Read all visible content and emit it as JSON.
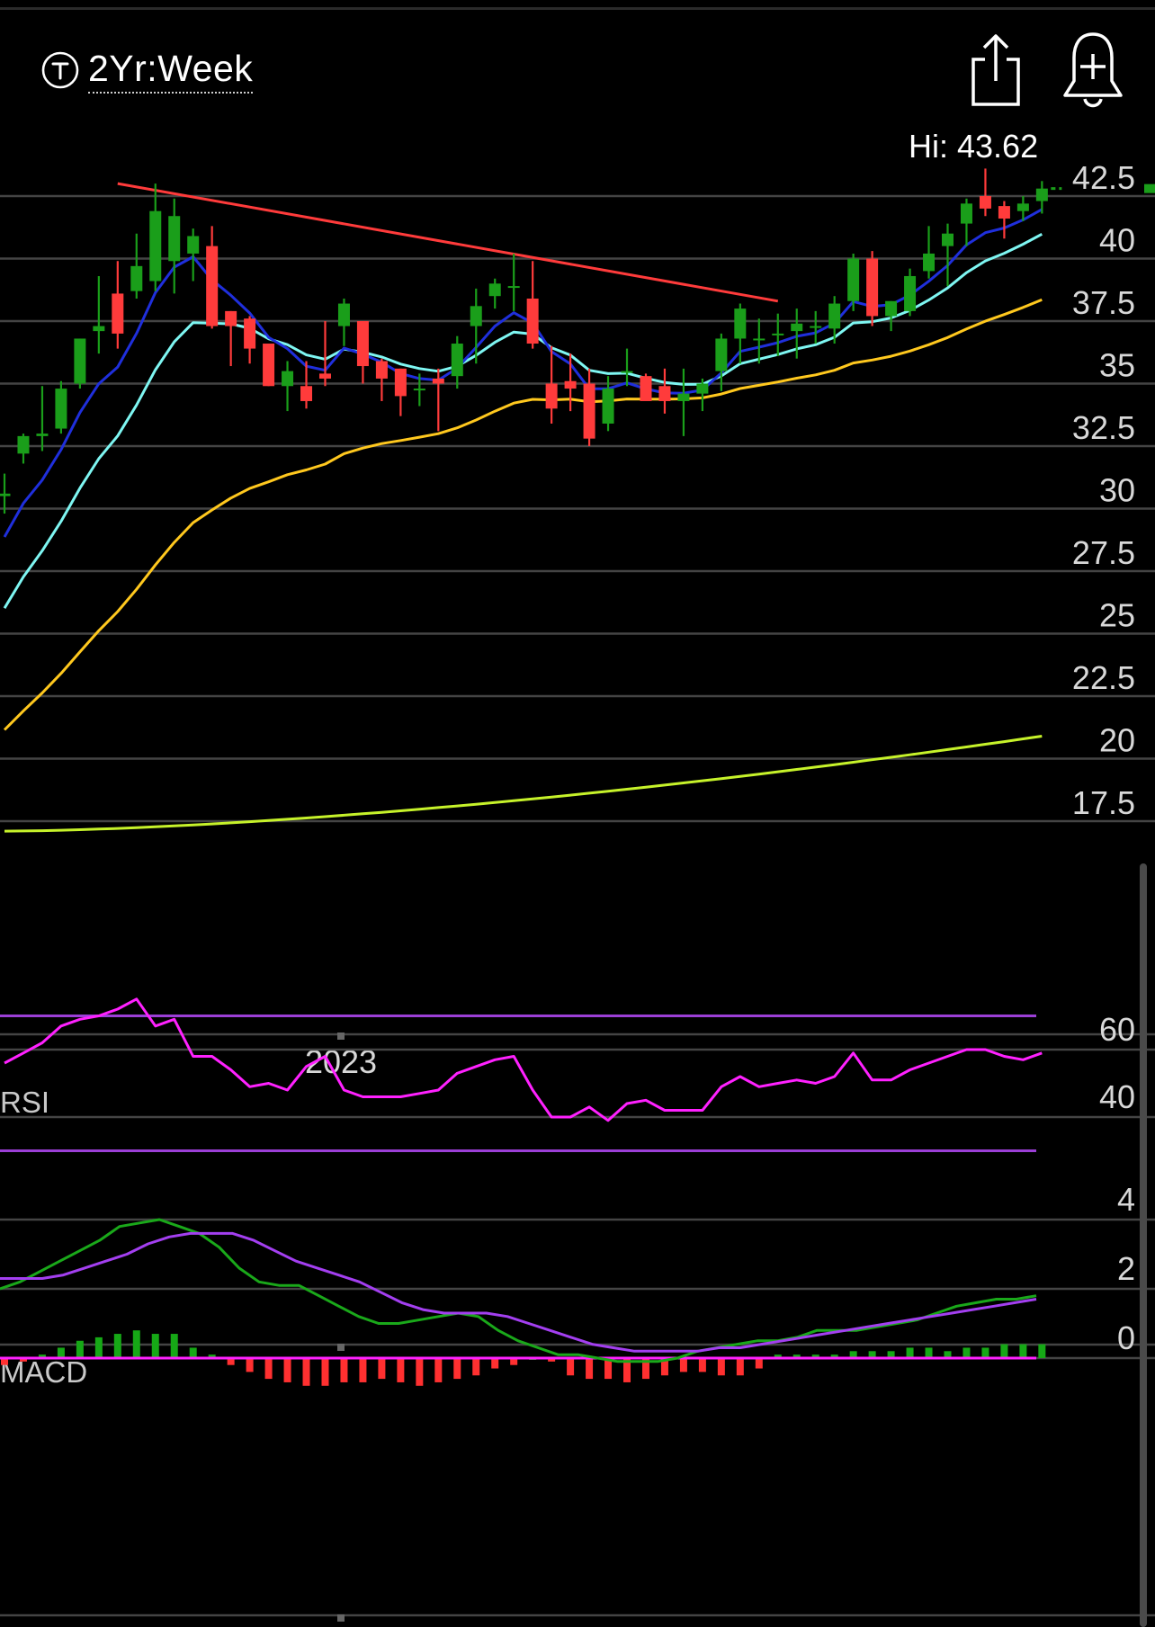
{
  "header": {
    "range_label": "2Yr:Week",
    "range_icon": "t-circle-icon",
    "share_icon": "share-icon",
    "alert_icon": "add-alert-bell-icon",
    "hi_label": "Hi: 43.62"
  },
  "chart_data": [
    {
      "type": "candlestick",
      "title": "",
      "x_label": "2023",
      "y_ticks": [
        "42.5",
        "40",
        "37.5",
        "35",
        "32.5",
        "30",
        "27.5",
        "25",
        "22.5",
        "20",
        "17.5"
      ],
      "y_tick_values": [
        42.5,
        40,
        37.5,
        35,
        32.5,
        30,
        27.5,
        25,
        22.5,
        20,
        17.5
      ],
      "ylim": [
        15,
        43.6
      ],
      "grid": true,
      "colors": {
        "up": "#1a9e1a",
        "down": "#ff3b3b",
        "ma_fast": "#1f2fdc",
        "ma_mid": "#7ef6f2",
        "ma_slow": "#ffc81e",
        "ma_long": "#c6f22a",
        "trendline": "#ff3b3b"
      },
      "candles": [
        [
          30.5,
          31.4,
          29.8,
          30.6
        ],
        [
          32.2,
          33.0,
          31.8,
          32.9
        ],
        [
          32.9,
          34.9,
          32.3,
          33.0
        ],
        [
          33.2,
          35.1,
          33.0,
          34.8
        ],
        [
          35.0,
          36.8,
          34.8,
          36.8
        ],
        [
          37.1,
          39.3,
          36.2,
          37.3
        ],
        [
          38.6,
          39.9,
          36.4,
          37.0
        ],
        [
          38.7,
          41.0,
          38.4,
          39.7
        ],
        [
          39.1,
          43.0,
          38.7,
          41.9
        ],
        [
          39.9,
          42.4,
          38.6,
          41.7
        ],
        [
          40.2,
          41.2,
          39.1,
          40.9
        ],
        [
          40.5,
          41.3,
          37.2,
          37.3
        ],
        [
          37.9,
          37.9,
          35.7,
          37.3
        ],
        [
          37.6,
          37.7,
          35.8,
          36.4
        ],
        [
          36.6,
          36.6,
          34.9,
          34.9
        ],
        [
          34.9,
          35.9,
          33.9,
          35.5
        ],
        [
          34.9,
          35.9,
          34.0,
          34.3
        ],
        [
          35.4,
          37.5,
          34.9,
          35.2
        ],
        [
          37.3,
          38.4,
          36.5,
          38.2
        ],
        [
          37.5,
          37.5,
          35.0,
          35.7
        ],
        [
          35.9,
          36.0,
          34.3,
          35.2
        ],
        [
          35.6,
          35.6,
          33.7,
          34.5
        ],
        [
          34.8,
          35.4,
          34.1,
          34.8
        ],
        [
          35.2,
          35.6,
          33.1,
          35.0
        ],
        [
          35.3,
          36.9,
          34.8,
          36.6
        ],
        [
          37.3,
          38.8,
          35.8,
          38.1
        ],
        [
          38.5,
          39.2,
          38.0,
          39.0
        ],
        [
          38.9,
          40.2,
          37.9,
          38.9
        ],
        [
          38.4,
          39.9,
          36.4,
          36.6
        ],
        [
          35.0,
          36.5,
          33.4,
          34.0
        ],
        [
          35.1,
          36.2,
          33.9,
          34.8
        ],
        [
          35.0,
          35.6,
          32.5,
          32.8
        ],
        [
          33.4,
          35.3,
          33.1,
          34.8
        ],
        [
          35.5,
          36.4,
          34.9,
          35.5
        ],
        [
          35.3,
          35.4,
          34.4,
          34.3
        ],
        [
          34.9,
          35.6,
          33.8,
          34.3
        ],
        [
          34.3,
          35.6,
          32.9,
          34.6
        ],
        [
          34.6,
          35.2,
          33.9,
          35.0
        ],
        [
          35.5,
          37.0,
          34.7,
          36.8
        ],
        [
          36.8,
          38.2,
          35.8,
          38.0
        ],
        [
          36.8,
          37.6,
          35.8,
          36.8
        ],
        [
          37.0,
          37.8,
          36.1,
          37.0
        ],
        [
          37.1,
          38.0,
          36.0,
          37.4
        ],
        [
          37.3,
          37.9,
          36.6,
          37.3
        ],
        [
          37.2,
          38.5,
          36.6,
          38.2
        ],
        [
          38.3,
          40.2,
          37.9,
          40.0
        ],
        [
          40.0,
          40.3,
          37.3,
          37.7
        ],
        [
          37.7,
          38.3,
          37.1,
          38.3
        ],
        [
          37.9,
          39.6,
          37.7,
          39.3
        ],
        [
          39.5,
          41.3,
          39.2,
          40.2
        ],
        [
          40.5,
          41.4,
          38.9,
          41.0
        ],
        [
          41.4,
          42.4,
          40.5,
          42.2
        ],
        [
          42.5,
          43.6,
          41.7,
          42.0
        ],
        [
          42.1,
          42.3,
          40.8,
          41.6
        ],
        [
          41.9,
          42.5,
          41.5,
          42.2
        ],
        [
          42.3,
          43.1,
          41.8,
          42.8
        ]
      ]
    },
    {
      "type": "line",
      "title": "RSI",
      "y_ticks": [
        "60",
        "40"
      ],
      "y_tick_values": [
        60,
        40
      ],
      "upper_band": 70,
      "lower_band": 30,
      "series": [
        {
          "values": [
            56,
            59,
            62,
            67,
            69,
            70,
            72,
            75,
            67,
            69,
            58,
            58,
            54,
            49,
            50,
            48,
            55,
            58,
            48,
            46,
            46,
            46,
            47,
            48,
            53,
            55,
            57,
            58,
            48,
            40,
            40,
            43,
            39,
            44,
            45,
            42,
            42,
            42,
            49,
            52,
            49,
            50,
            51,
            50,
            52,
            59,
            51,
            51,
            54,
            56,
            58,
            60,
            60,
            58,
            57,
            59
          ]
        }
      ]
    },
    {
      "type": "bar",
      "title": "MACD",
      "y_ticks": [
        "4",
        "2",
        "0"
      ],
      "y_tick_values": [
        4,
        2,
        0
      ],
      "ylim": [
        -1.6,
        4.6
      ],
      "series": [
        {
          "values": [
            2.0,
            2.2,
            2.5,
            2.8,
            3.1,
            3.4,
            3.8,
            3.9,
            4.0,
            3.8,
            3.6,
            3.2,
            2.6,
            2.2,
            2.1,
            2.1,
            1.8,
            1.5,
            1.2,
            1.0,
            1.0,
            1.1,
            1.2,
            1.3,
            1.2,
            0.8,
            0.5,
            0.3,
            0.1,
            0.1,
            0.0,
            -0.1,
            -0.1,
            -0.1,
            0.0,
            0.2,
            0.3,
            0.4,
            0.5,
            0.5,
            0.6,
            0.8,
            0.8,
            0.8,
            0.9,
            1.0,
            1.1,
            1.3,
            1.5,
            1.6,
            1.7,
            1.7,
            1.8
          ]
        },
        {
          "values": [
            2.3,
            2.3,
            2.3,
            2.4,
            2.6,
            2.8,
            3.0,
            3.3,
            3.5,
            3.6,
            3.6,
            3.6,
            3.4,
            3.1,
            2.8,
            2.6,
            2.4,
            2.2,
            1.9,
            1.6,
            1.4,
            1.3,
            1.3,
            1.3,
            1.2,
            1.0,
            0.8,
            0.6,
            0.4,
            0.3,
            0.2,
            0.2,
            0.2,
            0.2,
            0.3,
            0.3,
            0.4,
            0.5,
            0.6,
            0.7,
            0.8,
            0.9,
            1.0,
            1.1,
            1.2,
            1.3,
            1.4,
            1.5,
            1.6,
            1.7
          ]
        },
        {
          "values": [
            -0.2,
            -0.1,
            0.1,
            0.3,
            0.5,
            0.6,
            0.7,
            0.8,
            0.7,
            0.7,
            0.3,
            0.1,
            -0.2,
            -0.4,
            -0.6,
            -0.7,
            -0.8,
            -0.8,
            -0.7,
            -0.7,
            -0.6,
            -0.7,
            -0.8,
            -0.7,
            -0.6,
            -0.5,
            -0.3,
            -0.2,
            0.0,
            -0.1,
            -0.5,
            -0.6,
            -0.6,
            -0.7,
            -0.6,
            -0.5,
            -0.4,
            -0.4,
            -0.5,
            -0.5,
            -0.3,
            0.1,
            0.1,
            0.1,
            0.1,
            0.2,
            0.2,
            0.2,
            0.3,
            0.3,
            0.2,
            0.3,
            0.3,
            0.4,
            0.4,
            0.4
          ]
        }
      ]
    }
  ]
}
